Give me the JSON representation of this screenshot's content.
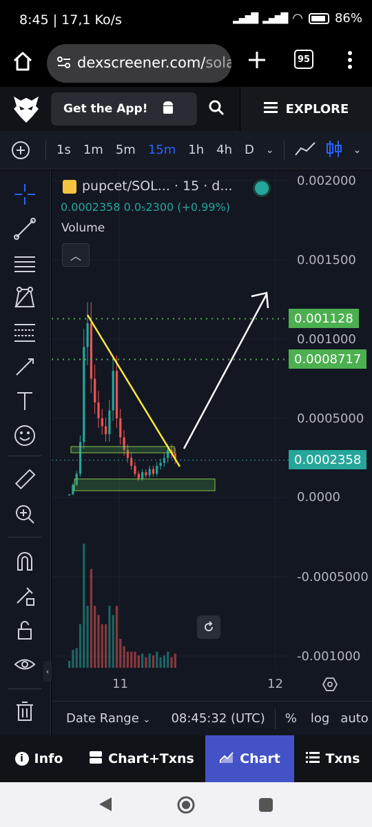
{
  "status": {
    "time": "8:45 | 17,1 Ko/s",
    "battery": "86%"
  },
  "browser": {
    "url_main": "dexscreener.com/",
    "url_rest": "sola",
    "tab_count": "95"
  },
  "header": {
    "get_app_label": "Get the App!",
    "explore_label": "EXPLORE"
  },
  "timeframes": [
    "1s",
    "1m",
    "5m",
    "15m",
    "1h",
    "4h",
    "D"
  ],
  "active_timeframe": "15m",
  "legend": {
    "title": "pupcet/SOL... · 15 · d...",
    "values": "0.0002358  0.0₅2300 (+0.99%)",
    "volume_label": "Volume"
  },
  "price_axis": {
    "labels": [
      "0.002000",
      "0.001500",
      "0.001000",
      "0.0005000",
      "0.0000",
      "-0.0005000",
      "-0.001000"
    ],
    "tags": [
      {
        "text": "0.001128",
        "color": "#4caf50"
      },
      {
        "text": "0.0008717",
        "color": "#4caf50"
      },
      {
        "text": "0.0002358",
        "color": "#26a69a"
      }
    ]
  },
  "time_axis": {
    "labels": [
      "11",
      "12"
    ]
  },
  "bottom": {
    "date_range": "Date Range",
    "clock": "08:45:32 (UTC)",
    "percent": "%",
    "log": "log",
    "auto": "auto"
  },
  "tabs": [
    {
      "label": "Info",
      "icon": "info-icon"
    },
    {
      "label": "Chart+Txns",
      "icon": "split-layout-icon"
    },
    {
      "label": "Chart",
      "icon": "chart-icon"
    },
    {
      "label": "Txns",
      "icon": "list-icon"
    }
  ],
  "active_tab": "Chart",
  "colors": {
    "up": "#26a69a",
    "down": "#ef5350",
    "accent": "#2962ff",
    "trendline": "#ffeb3b"
  },
  "chart_data": {
    "type": "candlestick",
    "symbol": "pupcet/SOL",
    "interval": "15",
    "last_price": 0.0002358,
    "change_percent": 0.99,
    "x_ticks": [
      "11",
      "12"
    ],
    "ylim": [
      -0.0011,
      0.002
    ],
    "horizontal_levels": [
      0.001128,
      0.0008717,
      0.0002358
    ],
    "annotations": [
      {
        "kind": "trendline",
        "from": [
          0.0011,
          0.00112
        ],
        "to": [
          0.00028,
          0.00025
        ]
      },
      {
        "kind": "arrow",
        "direction": "up"
      },
      {
        "kind": "zone",
        "range": [
          0.0003,
          0.00028
        ]
      },
      {
        "kind": "zone",
        "range": [
          0.000115,
          4e-05
        ]
      }
    ],
    "close_series": [
      2e-05,
      8e-05,
      0.00015,
      0.00035,
      0.00095,
      0.0011,
      0.00075,
      0.0006,
      0.0005,
      0.00045,
      0.0004,
      0.00055,
      0.0008,
      0.0005,
      0.00038,
      0.0003,
      0.00025,
      0.0002,
      0.00015,
      0.00012,
      0.00016,
      0.00014,
      0.00018,
      0.00015,
      0.0002,
      0.00022,
      0.00025,
      0.0003,
      0.00028,
      0.00024
    ]
  }
}
